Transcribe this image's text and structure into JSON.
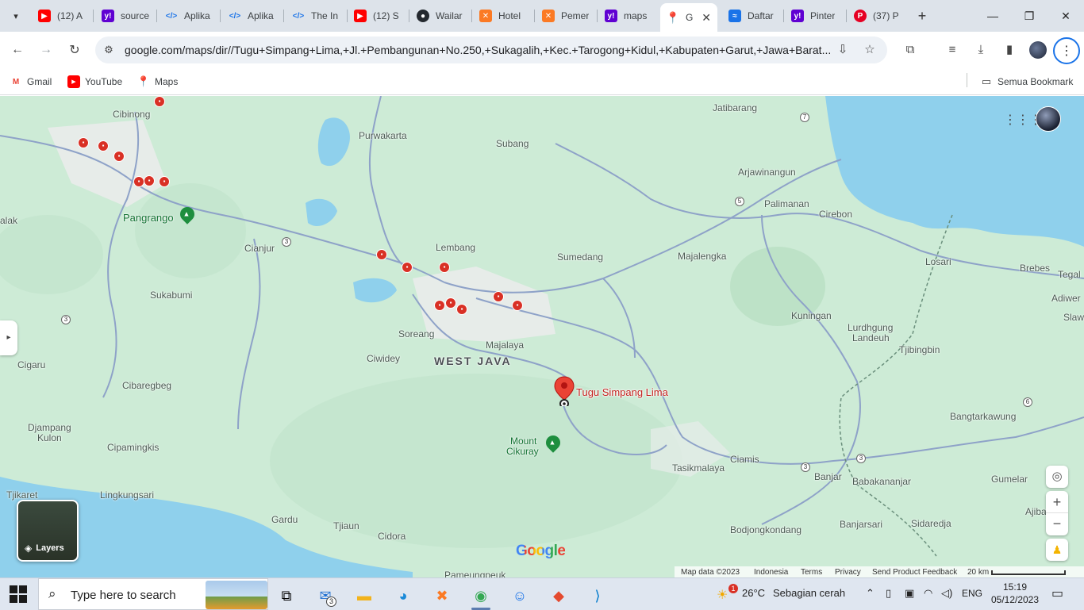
{
  "browser": {
    "tabs": [
      {
        "title": "(12) A",
        "favicon": "youtube-icon",
        "color": "#ff0000"
      },
      {
        "title": "source",
        "favicon": "yahoo-icon",
        "color": "#6001d2"
      },
      {
        "title": "Aplika",
        "favicon": "code-icon",
        "color": "#1a73e8"
      },
      {
        "title": "Aplika",
        "favicon": "code-icon",
        "color": "#1a73e8"
      },
      {
        "title": "The In",
        "favicon": "code-icon",
        "color": "#1a73e8"
      },
      {
        "title": "(12) S",
        "favicon": "youtube-icon",
        "color": "#ff0000"
      },
      {
        "title": "Wailar",
        "favicon": "github-icon",
        "color": "#24292f"
      },
      {
        "title": "Hotel",
        "favicon": "xampp-icon",
        "color": "#fb7a24"
      },
      {
        "title": "Pemer",
        "favicon": "xampp-icon",
        "color": "#fb7a24"
      },
      {
        "title": "maps",
        "favicon": "yahoo-icon",
        "color": "#6001d2"
      },
      {
        "title": "G",
        "favicon": "google-maps-icon",
        "color": "#34a853",
        "active": true
      },
      {
        "title": "Daftar",
        "favicon": "chart-icon",
        "color": "#1a73e8"
      },
      {
        "title": "Pinter",
        "favicon": "yahoo-icon",
        "color": "#6001d2"
      },
      {
        "title": "(37) P",
        "favicon": "pinterest-icon",
        "color": "#e60023"
      }
    ],
    "url": "google.com/maps/dir//Tugu+Simpang+Lima,+Jl.+Pembangunan+No.250,+Sukagalih,+Kec.+Tarogong+Kidul,+Kabupaten+Garut,+Jawa+Barat...",
    "bookmarks": [
      {
        "label": "Gmail",
        "icon": "gmail-icon"
      },
      {
        "label": "YouTube",
        "icon": "youtube-icon"
      },
      {
        "label": "Maps",
        "icon": "google-maps-icon"
      }
    ],
    "all_bookmarks": "Semua Bookmark"
  },
  "map": {
    "region_label": "WEST JAVA",
    "places": {
      "jatibarang": "Jatibarang",
      "cibinong": "Cibinong",
      "purwakarta": "Purwakarta",
      "subang": "Subang",
      "arjawinangun": "Arjawinangun",
      "palimanan": "Palimanan",
      "cirebon": "Cirebon",
      "pangrango": "Pangrango",
      "cianjur": "Cianjur",
      "lembang": "Lembang",
      "sumedang": "Sumedang",
      "majalengka": "Majalengka",
      "losari": "Losari",
      "brebes": "Brebes",
      "tegal": "Tegal",
      "sukabumi": "Sukabumi",
      "adiwerna": "Adiwer",
      "slawi": "Slawi",
      "kuningan": "Kuningan",
      "lurahgung": "Lurdhgung",
      "landeuh": "Landeuh",
      "soreang": "Soreang",
      "majalaya": "Majalaya",
      "tjibingbin": "Tjibingbin",
      "cigaru": "Cigaru",
      "ciwidey": "Ciwidey",
      "cibaregbeg": "Cibaregbeg",
      "bangtarkawung": "Bangtarkawung",
      "djampang": "Djampang",
      "kulon": "Kulon",
      "cipamingkis": "Cipamingkis",
      "mount_cikuray_1": "Mount",
      "mount_cikuray_2": "Cikuray",
      "ciamis": "Ciamis",
      "tasikmalaya": "Tasikmalaya",
      "banjar": "Banjar",
      "babakananjar": "Babakananjar",
      "gumelar": "Gumelar",
      "tjikaret": "Tjikaret",
      "lingkungsari": "Lingkungsari",
      "ajiba": "Ajiba",
      "gardu": "Gardu",
      "tjiaun": "Tjiaun",
      "cidora": "Cidora",
      "bodjongkondang": "Bodjongkondang",
      "banjarsari": "Banjarsari",
      "sidaredja": "Sidaredja",
      "pameungpeuk": "Pameungpeuk",
      "alak": "alak"
    },
    "highways": [
      "7",
      "5",
      "3",
      "3",
      "6",
      "3",
      "3"
    ],
    "marker_label": "Tugu Simpang Lima",
    "layers_label": "Layers",
    "logo": "Google",
    "attribution": {
      "map_data": "Map data ©2023",
      "country": "Indonesia",
      "terms": "Terms",
      "privacy": "Privacy",
      "feedback": "Send Product Feedback",
      "scale": "20 km"
    },
    "colors": {
      "land": "#cdebd6",
      "water": "#8fd0ec",
      "road": "#8ea2c8",
      "urban": "#e7ece9",
      "marker": "#ea4335"
    }
  },
  "taskbar": {
    "search_placeholder": "Type here to search",
    "mail_badge": "3",
    "weather_badge": "1",
    "temperature": "26°C",
    "weather_text": "Sebagian cerah",
    "language": "ENG",
    "time": "15:19",
    "date": "05/12/2023"
  }
}
